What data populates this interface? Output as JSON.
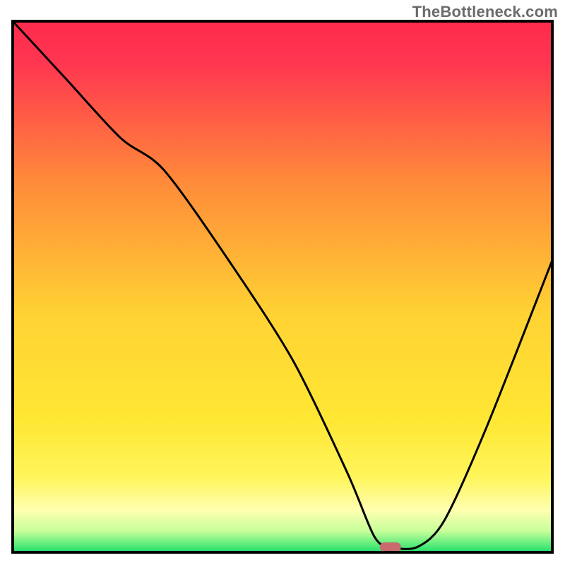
{
  "watermark": "TheBottleneck.com",
  "chart_data": {
    "type": "line",
    "title": "",
    "xlabel": "",
    "ylabel": "",
    "xlim": [
      0,
      100
    ],
    "ylim": [
      0,
      100
    ],
    "series": [
      {
        "name": "curve",
        "x": [
          0,
          10,
          20,
          28,
          40,
          52,
          62,
          67,
          70,
          75,
          80,
          88,
          100
        ],
        "y": [
          100,
          89,
          78,
          72,
          55,
          36,
          15,
          3,
          1,
          1,
          6,
          24,
          55
        ]
      }
    ],
    "marker": {
      "x": 70,
      "y": 1,
      "color": "#c96a6f"
    },
    "gradient_stops": [
      {
        "offset": 0.0,
        "color": "#ff2a4c"
      },
      {
        "offset": 0.08,
        "color": "#ff3650"
      },
      {
        "offset": 0.3,
        "color": "#ff8a3a"
      },
      {
        "offset": 0.55,
        "color": "#ffd233"
      },
      {
        "offset": 0.75,
        "color": "#ffe733"
      },
      {
        "offset": 0.86,
        "color": "#fff55c"
      },
      {
        "offset": 0.92,
        "color": "#ffffb0"
      },
      {
        "offset": 0.96,
        "color": "#c7ff9a"
      },
      {
        "offset": 1.0,
        "color": "#1fe06a"
      }
    ],
    "frame_color": "#000000",
    "curve_color": "#000000"
  }
}
